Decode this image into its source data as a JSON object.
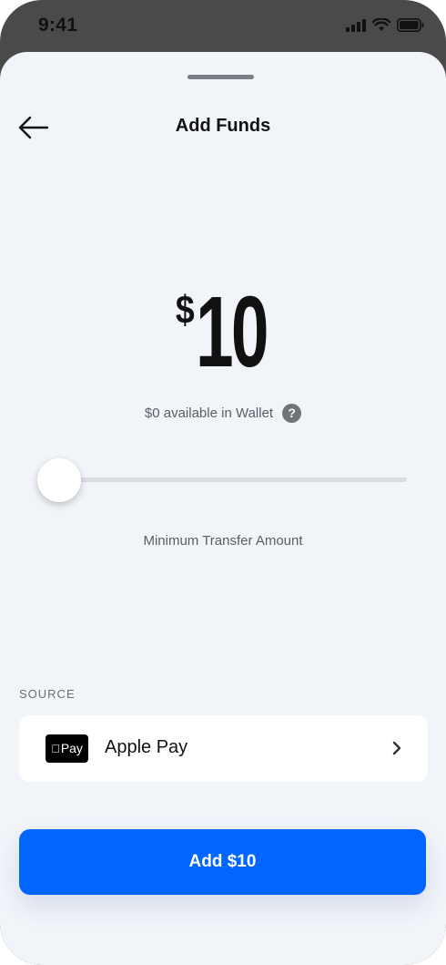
{
  "status_bar": {
    "time": "9:41",
    "icons": [
      "signal-icon",
      "wifi-icon",
      "battery-icon"
    ]
  },
  "header": {
    "title": "Add Funds",
    "back_icon": "arrow-left-icon"
  },
  "amount": {
    "currency": "$",
    "value": "10"
  },
  "wallet": {
    "available_text": "$0 available in Wallet",
    "help_glyph": "?"
  },
  "slider": {
    "level_fraction": 0.0
  },
  "min_label": "Minimum Transfer Amount",
  "source": {
    "section_label": "SOURCE",
    "badge_text": "Pay",
    "name": "Apple Pay"
  },
  "primary_button": {
    "label": "Add $10",
    "color": "#0066ff"
  },
  "colors": {
    "sheet_background": "#f1f4f9",
    "accent": "#0066ff"
  }
}
